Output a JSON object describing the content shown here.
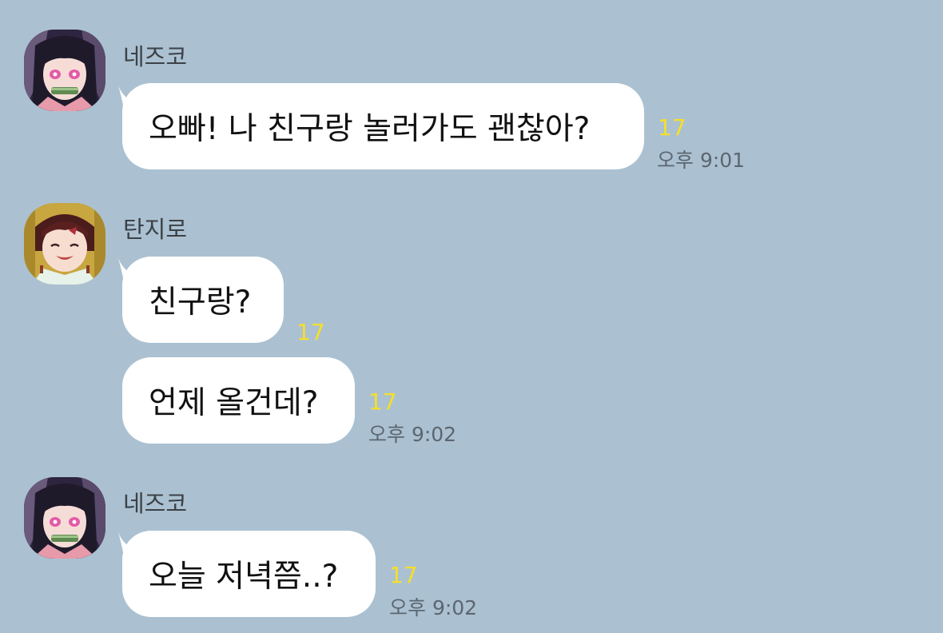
{
  "messages": [
    {
      "sender": "네즈코",
      "text": "오빠! 나 친구랑 놀러가도 괜찮아?",
      "unread": "17",
      "time": "오후 9:01"
    },
    {
      "sender": "탄지로",
      "text": "친구랑?",
      "unread": "17"
    },
    {
      "text": "언제 올건데?",
      "unread": "17",
      "time": "오후 9:02"
    },
    {
      "sender": "네즈코",
      "text": "오늘 저녁쯤..?",
      "unread": "17",
      "time": "오후 9:02"
    }
  ],
  "colors": {
    "background": "#abc1d1",
    "bubble": "#ffffff",
    "unread": "#f5df2a",
    "time": "#5c6670"
  }
}
